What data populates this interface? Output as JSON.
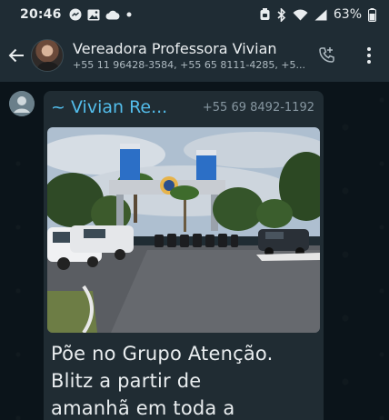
{
  "status_bar": {
    "time": "20:46",
    "battery": "63%"
  },
  "header": {
    "title": "Vereadora Professora Vivian",
    "subtitle": "+55 11 96428-3584, +55 65 8111-4285, +5..."
  },
  "message": {
    "sender_name": "~ Vivian Re...",
    "sender_phone": "+55 69 8492-1192",
    "text_lines": [
      "Põe no Grupo Atenção.",
      "Blitz a partir de",
      "amanhã em toda a"
    ]
  },
  "colors": {
    "bar_bg": "#1f2c34",
    "chat_bg": "#0b141a",
    "bubble_bg": "#202c33",
    "sender_name": "#53bdeb"
  },
  "icons": {
    "status_left": [
      "facebook-messenger-icon",
      "gallery-icon",
      "cloud-icon",
      "dot-icon"
    ],
    "status_right": [
      "alarm-icon",
      "bluetooth-icon",
      "wifi-icon",
      "signal-icon",
      "battery-icon"
    ],
    "header_actions": [
      "add-call-icon",
      "more-vert-icon"
    ]
  }
}
